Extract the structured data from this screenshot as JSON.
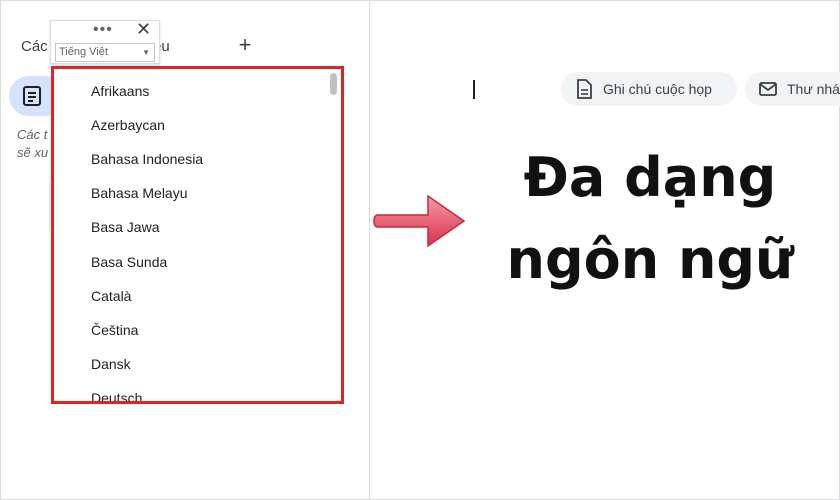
{
  "sidebar": {
    "title_visible": "Các t",
    "title_tail": "ệu",
    "hint_line_1": "Các t",
    "hint_line_2": "sẽ xu"
  },
  "language_picker": {
    "selected_language": "Tiếng Việt",
    "options": [
      "Afrikaans",
      "Azerbaycan",
      "Bahasa Indonesia",
      "Bahasa Melayu",
      "Basa Jawa",
      "Basa Sunda",
      "Català",
      "Čeština",
      "Dansk",
      "Deutsch"
    ]
  },
  "document": {
    "chips": [
      {
        "label": "Ghi chú cuộc họp",
        "icon": "doc-icon"
      },
      {
        "label": "Thư nháp",
        "icon": "mail-icon"
      }
    ]
  },
  "overlay": {
    "headline_line_1": "Đa dạng",
    "headline_line_2": "ngôn ngữ",
    "arrow_color": "#e8556a",
    "highlight_color": "#e02424"
  }
}
